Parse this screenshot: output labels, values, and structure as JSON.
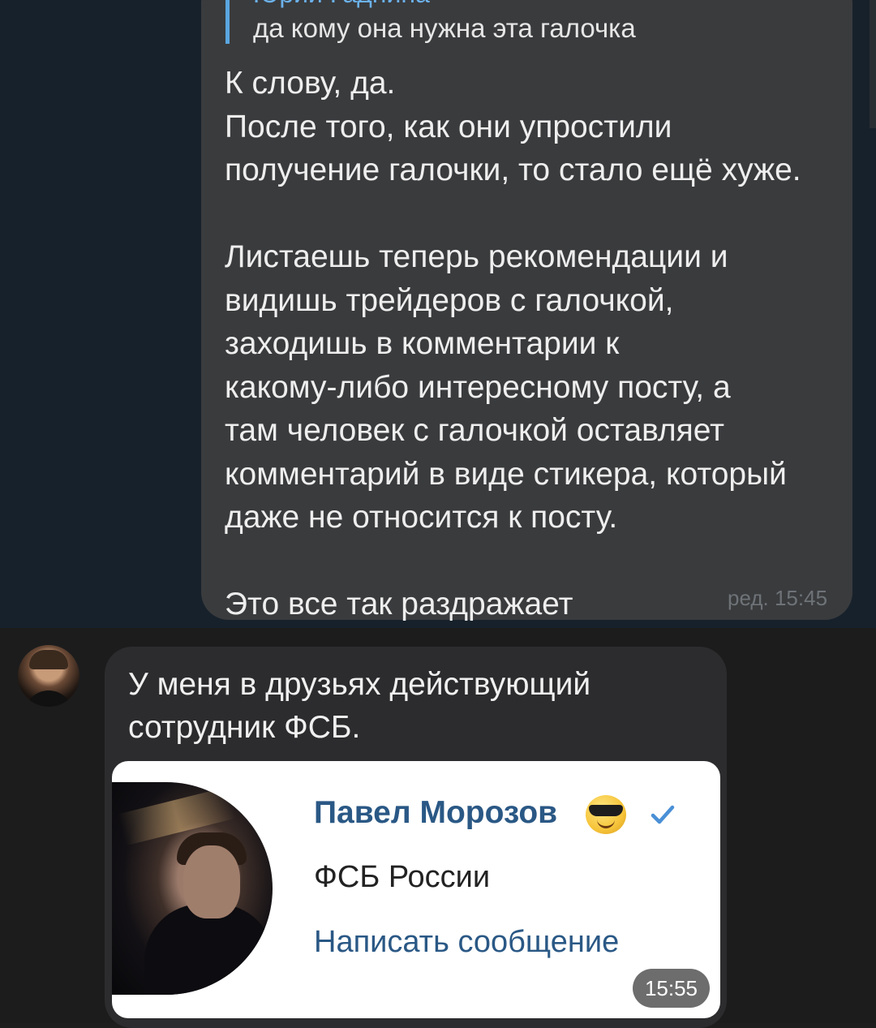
{
  "top_message": {
    "reply_author": "Юрий Гаднина",
    "reply_text": "да кому она нужна эта галочка",
    "text": "К слову, да.\nПосле того, как они упростили\nполучение галочки, то стало ещё хуже.\n\nЛистаешь теперь рекомендации и\nвидишь трейдеров с галочкой,\nзаходишь в комментарии к\nкакому-либо интересному посту, а\nтам человек с галочкой оставляет\nкомментарий в виде стикера, который\nдаже не относится к посту.\n\nЭто все так раздражает",
    "time": "ред. 15:45"
  },
  "incoming_message": {
    "text": "У меня в друзьях действующий\nсотрудник ФСБ.",
    "profile_card": {
      "name": "Павел Морозов",
      "emoji": "smiling-face-with-sunglasses-icon",
      "verified_icon": "verified-check-icon",
      "subtitle": "ФСБ России",
      "action": "Написать сообщение"
    },
    "time": "15:55"
  },
  "colors": {
    "top_background": "#17212b",
    "bottom_background": "#1c1c1d",
    "bubble_top": "#3a3b3d",
    "bubble_incoming": "#2c2c2e",
    "link_blue": "#2a5885",
    "reply_accent": "#5aa6e0"
  }
}
